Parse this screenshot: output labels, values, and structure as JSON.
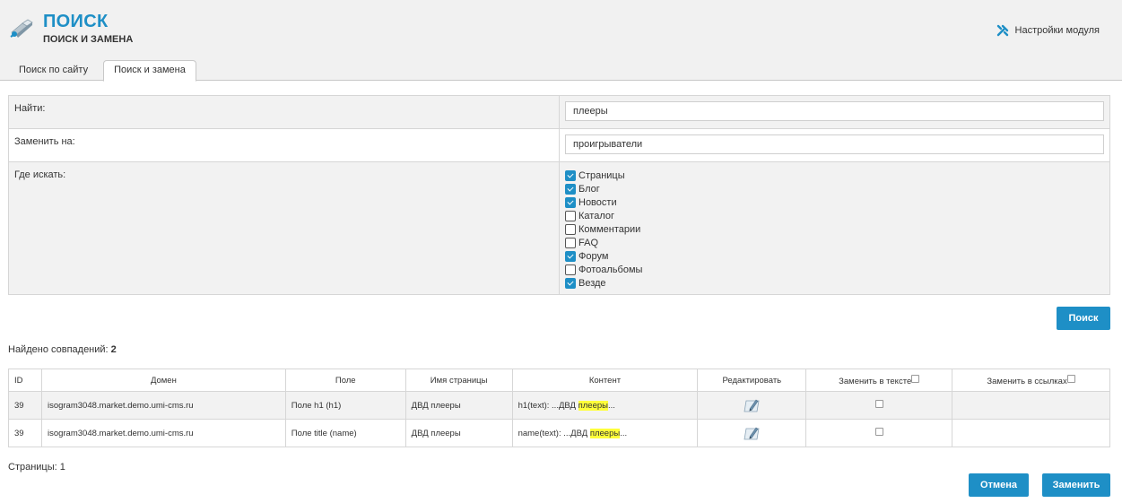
{
  "header": {
    "title": "ПОИСК",
    "subtitle": "ПОИСК И ЗАМЕНА",
    "settings_label": "Настройки модуля"
  },
  "tabs": [
    {
      "label": "Поиск по сайту",
      "active": false
    },
    {
      "label": "Поиск и замена",
      "active": true
    }
  ],
  "form": {
    "find_label": "Найти:",
    "find_value": "плееры",
    "replace_label": "Заменить на:",
    "replace_value": "проигрыватели",
    "where_label": "Где искать:",
    "where_options": [
      {
        "label": "Страницы",
        "checked": true
      },
      {
        "label": "Блог",
        "checked": true
      },
      {
        "label": "Новости",
        "checked": true
      },
      {
        "label": "Каталог",
        "checked": false
      },
      {
        "label": "Комментарии",
        "checked": false
      },
      {
        "label": "FAQ",
        "checked": false
      },
      {
        "label": "Форум",
        "checked": true
      },
      {
        "label": "Фотоальбомы",
        "checked": false
      },
      {
        "label": "Везде",
        "checked": true
      }
    ]
  },
  "buttons": {
    "search": "Поиск",
    "cancel": "Отмена",
    "replace": "Заменить"
  },
  "found": {
    "label": "Найдено совпадений:",
    "count": "2"
  },
  "table": {
    "columns": [
      "ID",
      "Домен",
      "Поле",
      "Имя страницы",
      "Контент",
      "Редактировать",
      "Заменить в тексте",
      "Заменить в ссылках"
    ],
    "rows": [
      {
        "id": "39",
        "domain": "isogram3048.market.demo.umi-cms.ru",
        "field": "Поле h1 (h1)",
        "page_name": "ДВД плееры",
        "content_prefix": "h1(text): ...ДВД ",
        "content_match": "плееры",
        "content_suffix": "..."
      },
      {
        "id": "39",
        "domain": "isogram3048.market.demo.umi-cms.ru",
        "field": "Поле title (name)",
        "page_name": "ДВД плееры",
        "content_prefix": "name(text): ...ДВД ",
        "content_match": "плееры",
        "content_suffix": "..."
      }
    ]
  },
  "pages": "Страницы: 1",
  "colors": {
    "accent": "#1e8fc6",
    "highlight": "#ffff3a"
  },
  "icons": {
    "logo": "search-module-icon",
    "settings": "wrench-icon",
    "edit": "edit-pencil-icon"
  }
}
